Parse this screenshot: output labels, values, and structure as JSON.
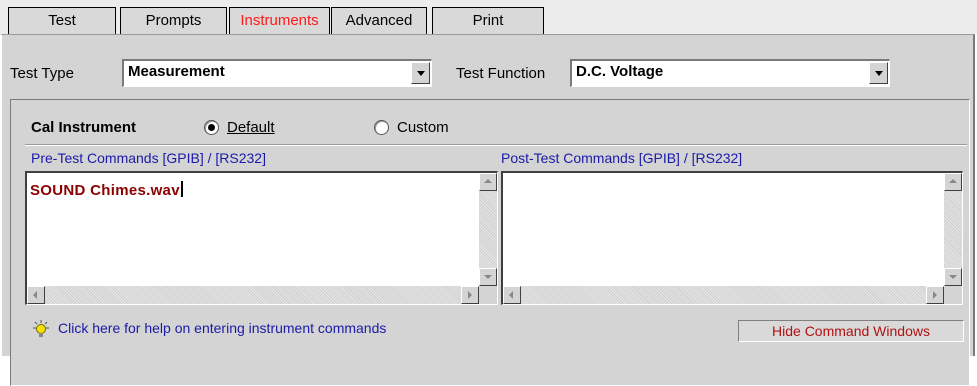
{
  "tabs": [
    {
      "label": "Test",
      "active": false
    },
    {
      "label": "Prompts",
      "active": false
    },
    {
      "label": "Instruments",
      "active": true
    },
    {
      "label": "Advanced",
      "active": false
    },
    {
      "label": "Print",
      "active": false
    }
  ],
  "test_type": {
    "label": "Test Type",
    "value": "Measurement"
  },
  "test_function": {
    "label": "Test Function",
    "value": "D.C. Voltage"
  },
  "cal_instrument": {
    "label": "Cal Instrument",
    "options": [
      {
        "label": "Default",
        "checked": true
      },
      {
        "label": "Custom",
        "checked": false
      }
    ]
  },
  "pre_test": {
    "label": "Pre-Test Commands [GPIB] / [RS232]",
    "value": "SOUND Chimes.wav"
  },
  "post_test": {
    "label": "Post-Test Commands [GPIB] / [RS232]",
    "value": ""
  },
  "help_link": "Click here for help on entering instrument commands",
  "hide_button": "Hide Command Windows",
  "colors": {
    "active_tab": "#ff1a1a",
    "command_label": "#1a1aa8",
    "command_text": "#8b0000",
    "hide_button_text": "#b11212"
  },
  "icons": [
    "lightbulb-icon",
    "dropdown-arrow-icon",
    "scroll-up-icon",
    "scroll-down-icon",
    "scroll-left-icon",
    "scroll-right-icon"
  ]
}
